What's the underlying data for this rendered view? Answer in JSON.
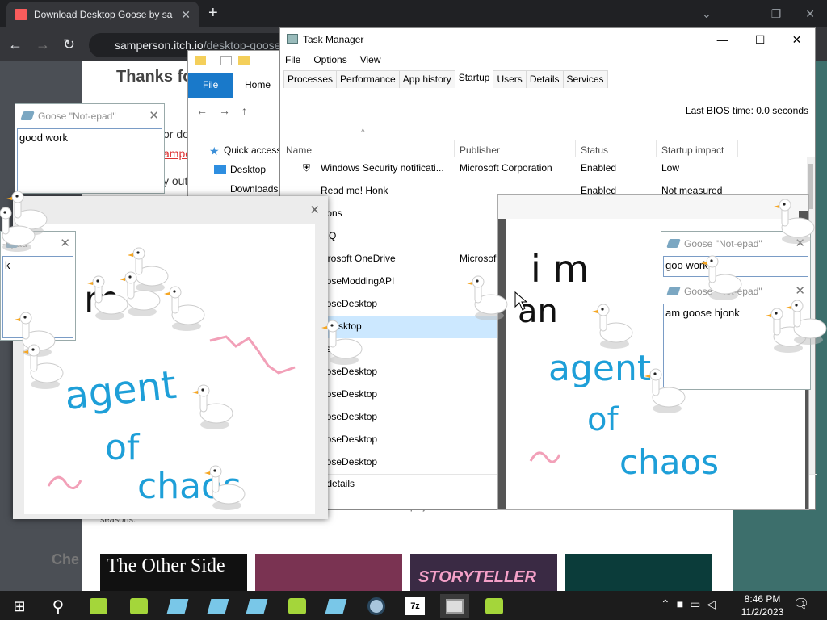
{
  "browser": {
    "tab_title": "Download Desktop Goose by sa",
    "url_host": "samperson.itch.io",
    "url_path": "/desktop-goose",
    "page_heading": "Thanks fo",
    "page_snippets": {
      "or_d": "or do",
      "samper": "amper",
      "y_out": "y out",
      "che": "Che",
      "prejudices": "prejudices and taboo",
      "seasons": "seasons."
    },
    "cards": [
      "The Other Side",
      "",
      "STORYTELLER",
      ""
    ]
  },
  "explorer": {
    "file_tab": "File",
    "home_tab": "Home",
    "quick_access": "Quick access",
    "desktop": "Desktop",
    "downloads": "Downloads"
  },
  "taskmgr": {
    "title": "Task Manager",
    "menu": [
      "File",
      "Options",
      "View"
    ],
    "tabs": [
      "Processes",
      "Performance",
      "App history",
      "Startup",
      "Users",
      "Details",
      "Services"
    ],
    "bios_label": "Last BIOS time:",
    "bios_value": "0.0 seconds",
    "columns": [
      "Name",
      "Publisher",
      "Status",
      "Startup impact"
    ],
    "rows": [
      {
        "name": "Windows Security notificati...",
        "publisher": "Microsoft Corporation",
        "status": "Enabled",
        "impact": "Low"
      },
      {
        "name": "Read me! Honk",
        "publisher": "",
        "status": "Enabled",
        "impact": "Not measured"
      },
      {
        "name": "trons",
        "publisher": "",
        "status": "",
        "impact": ""
      },
      {
        "name": "MQ",
        "publisher": "",
        "status": "",
        "impact": ""
      },
      {
        "name": "icrosoft OneDrive",
        "publisher": "Microsof",
        "status": "",
        "impact": ""
      },
      {
        "name": "ooseModdingAPI",
        "publisher": "",
        "status": "",
        "impact": ""
      },
      {
        "name": "ooseDesktop",
        "publisher": "",
        "status": "",
        "impact": ""
      },
      {
        "name": "eDesktop",
        "publisher": "",
        "status": "",
        "impact": ""
      },
      {
        "name": "esktop",
        "publisher": "",
        "status": "",
        "impact": ""
      },
      {
        "name": "ooseDesktop",
        "publisher": "",
        "status": "",
        "impact": ""
      },
      {
        "name": "ooseDesktop",
        "publisher": "",
        "status": "",
        "impact": ""
      },
      {
        "name": "ooseDesktop",
        "publisher": "",
        "status": "",
        "impact": ""
      },
      {
        "name": "ooseDesktop",
        "publisher": "",
        "status": "",
        "impact": ""
      },
      {
        "name": "ooseDesktop",
        "publisher": "",
        "status": "",
        "impact": ""
      }
    ],
    "fewer_details": "r details"
  },
  "notepads": [
    {
      "title": "Goose \"Not-epad\"",
      "text": "good work"
    },
    {
      "title": "-epad\"",
      "text": "k"
    },
    {
      "title": "Goose \"Not-epad\"",
      "text": "goo   work"
    },
    {
      "title": "Goose \"Not-epad\"",
      "text": "am goose hjonk"
    }
  ],
  "drawings": {
    "left": [
      "m",
      "agent",
      "of",
      "chaos"
    ],
    "right": [
      "i  m",
      "an",
      "agent",
      "of",
      "chaos"
    ]
  },
  "taskbar": {
    "time": "8:46 PM",
    "date": "11/2/2023",
    "notification_count": "1"
  },
  "colors": {
    "drawing_blue": "#1e9fd8",
    "pink": "#f2a0b8",
    "goose_white": "#ffffff",
    "goose_beak": "#f5a623"
  }
}
